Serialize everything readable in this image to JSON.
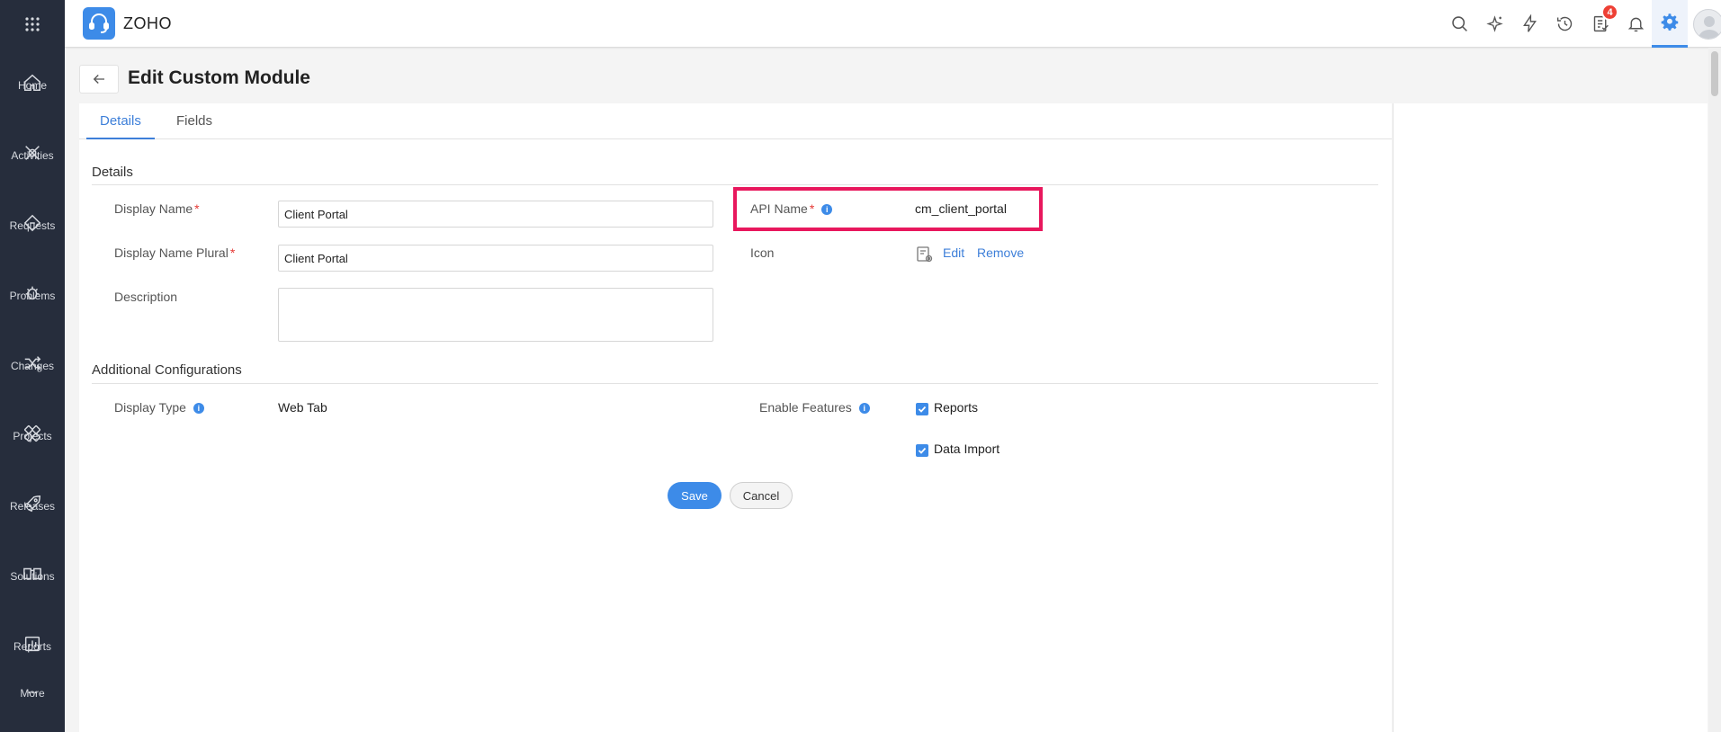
{
  "brand": {
    "name": "ZOHO"
  },
  "rail": {
    "items": [
      {
        "label": "Home",
        "icon": "home-icon"
      },
      {
        "label": "Activities",
        "icon": "activities-icon"
      },
      {
        "label": "Requests",
        "icon": "requests-icon"
      },
      {
        "label": "Problems",
        "icon": "problems-icon"
      },
      {
        "label": "Changes",
        "icon": "changes-icon"
      },
      {
        "label": "Projects",
        "icon": "projects-icon"
      },
      {
        "label": "Releases",
        "icon": "releases-icon"
      },
      {
        "label": "Solutions",
        "icon": "solutions-icon"
      },
      {
        "label": "Reports",
        "icon": "reports-icon"
      },
      {
        "label": "More",
        "icon": "more-icon"
      }
    ]
  },
  "topbar": {
    "notification_badge": "4"
  },
  "page": {
    "title": "Edit Custom Module"
  },
  "tabs": [
    {
      "label": "Details"
    },
    {
      "label": "Fields"
    }
  ],
  "details": {
    "section_title": "Details",
    "display_name": {
      "label": "Display Name",
      "value": "Client Portal"
    },
    "display_name_plural": {
      "label": "Display Name Plural",
      "value": "Client Portal"
    },
    "description": {
      "label": "Description",
      "value": ""
    },
    "api_name": {
      "label": "API Name",
      "value": "cm_client_portal"
    },
    "icon": {
      "label": "Icon",
      "edit": "Edit",
      "remove": "Remove"
    }
  },
  "additional": {
    "section_title": "Additional Configurations",
    "display_type": {
      "label": "Display Type",
      "value": "Web Tab"
    },
    "enable_features": {
      "label": "Enable Features",
      "options": [
        {
          "label": "Reports",
          "checked": true
        },
        {
          "label": "Data Import",
          "checked": true
        }
      ]
    }
  },
  "actions": {
    "save": "Save",
    "cancel": "Cancel"
  },
  "colors": {
    "accent": "#3d8be8",
    "rail": "#262d3c",
    "highlight": "#e8175d",
    "required": "#e53935"
  }
}
